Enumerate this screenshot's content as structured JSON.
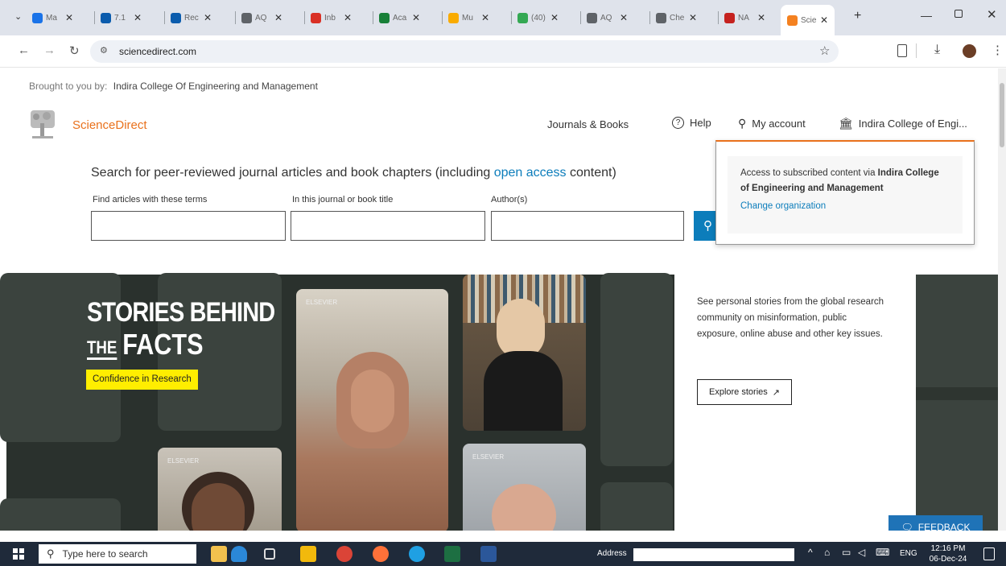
{
  "browser": {
    "tabs": [
      {
        "title": "Ma",
        "color": "#1a73e8"
      },
      {
        "title": "7.1",
        "color": "#0b5cad"
      },
      {
        "title": "Rec",
        "color": "#0b5cad"
      },
      {
        "title": "AQ",
        "color": "#5f6368"
      },
      {
        "title": "Inb",
        "color": "#d93025"
      },
      {
        "title": "Aca",
        "color": "#188038"
      },
      {
        "title": "Mu",
        "color": "#f9ab00"
      },
      {
        "title": "(40)",
        "color": "#34a853"
      },
      {
        "title": "AQ",
        "color": "#5f6368"
      },
      {
        "title": "Che",
        "color": "#5f6368"
      },
      {
        "title": "NA",
        "color": "#c5221f"
      },
      {
        "title": "Scie",
        "color": "#f48120"
      }
    ],
    "new_tab": "+",
    "url": "sciencedirect.com"
  },
  "page": {
    "brought_by_prefix": "Brought to you by:",
    "brought_by_org": "Indira College Of Engineering and Management",
    "logo_text": "ScienceDirect",
    "nav": {
      "journals_books": "Journals & Books",
      "help": "Help",
      "my_account": "My account",
      "institution": "Indira College of Engi..."
    },
    "search": {
      "heading_pre": "Search for peer-reviewed journal articles and book chapters (including ",
      "heading_link": "open access",
      "heading_post": " content)",
      "field1_label": "Find articles with these terms",
      "field2_label": "In this journal or book title",
      "field3_label": "Author(s)",
      "field1_value": "",
      "field2_value": "",
      "field3_value": ""
    },
    "popup": {
      "line1": "Access to subscribed content via ",
      "org_bold": "Indira College of Engineering and Management",
      "change_org": "Change organization"
    },
    "hero": {
      "title_line1": "STORIES BEHIND",
      "title_the": "THE",
      "title_facts": "FACTS",
      "tag": "Confidence in Research",
      "description": "See personal stories from the global research community on misinformation, public exposure, online abuse and other key issues.",
      "explore_button": "Explore stories",
      "elsevier_mark": "ELSEVIER"
    },
    "feedback": "FEEDBACK"
  },
  "taskbar": {
    "search_placeholder": "Type here to search",
    "address_label": "Address",
    "lang": "ENG",
    "time": "12:16 PM",
    "date": "06-Dec-24"
  },
  "colors": {
    "sd_orange": "#e9711c",
    "link_blue": "#0c7dbb",
    "search_btn": "#0c7dbb",
    "hero_bg": "#2a312d",
    "tag_yellow": "#ffee00",
    "feedback_blue": "#1f73b7"
  }
}
